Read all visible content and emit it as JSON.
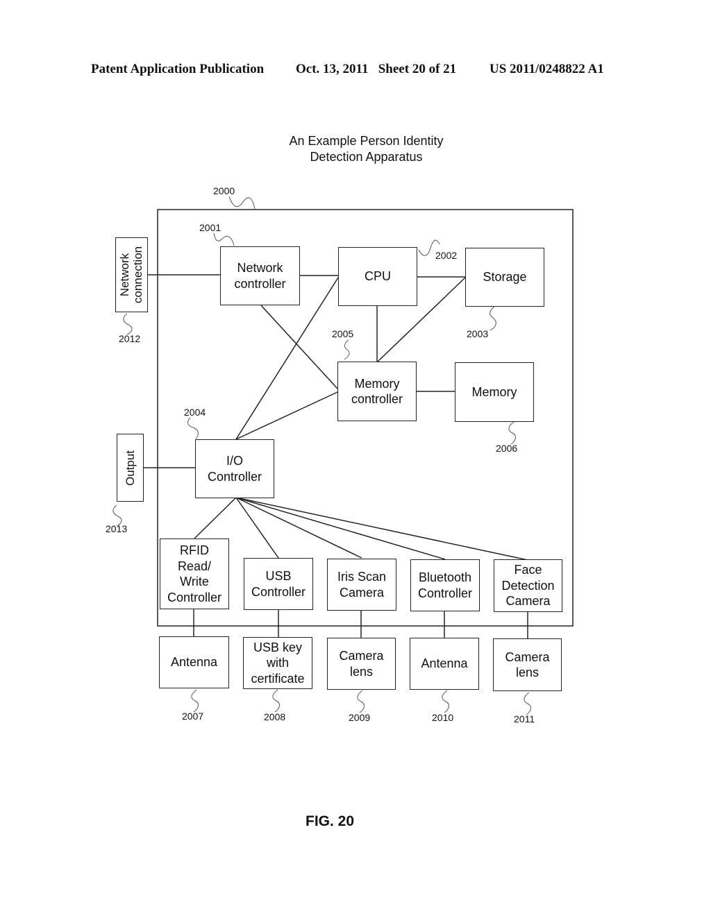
{
  "header": {
    "publication": "Patent Application Publication",
    "date_sheet": "Oct. 13, 2011   Sheet 20 of 21",
    "patent_number": "US 2011/0248822 A1"
  },
  "title": "An Example Person Identity\nDetection Apparatus",
  "figure_label": "FIG. 20",
  "apparatus_ref": "2000",
  "nodes": {
    "network_controller": {
      "label": "Network\ncontroller",
      "ref": "2001"
    },
    "cpu": {
      "label": "CPU",
      "ref": "2002"
    },
    "storage": {
      "label": "Storage",
      "ref": "2003"
    },
    "io_controller": {
      "label": "I/O\nController",
      "ref": "2004"
    },
    "memory_controller": {
      "label": "Memory\ncontroller",
      "ref": "2005"
    },
    "memory": {
      "label": "Memory",
      "ref": "2006"
    },
    "rfid_controller": {
      "label": "RFID\nRead/\nWrite\nController"
    },
    "usb_controller": {
      "label": "USB\nController"
    },
    "iris_camera": {
      "label": "Iris Scan\nCamera"
    },
    "bluetooth_controller": {
      "label": "Bluetooth\nController"
    },
    "face_camera": {
      "label": "Face\nDetection\nCamera"
    },
    "antenna_rfid": {
      "label": "Antenna",
      "ref": "2007"
    },
    "usb_key": {
      "label": "USB key\nwith\ncertificate",
      "ref": "2008"
    },
    "camera_lens_iris": {
      "label": "Camera\nlens",
      "ref": "2009"
    },
    "antenna_bt": {
      "label": "Antenna",
      "ref": "2010"
    },
    "camera_lens_face": {
      "label": "Camera\nlens",
      "ref": "2011"
    },
    "network_connection": {
      "label": "Network\nconnection",
      "ref": "2012"
    },
    "output": {
      "label": "Output",
      "ref": "2013"
    }
  }
}
